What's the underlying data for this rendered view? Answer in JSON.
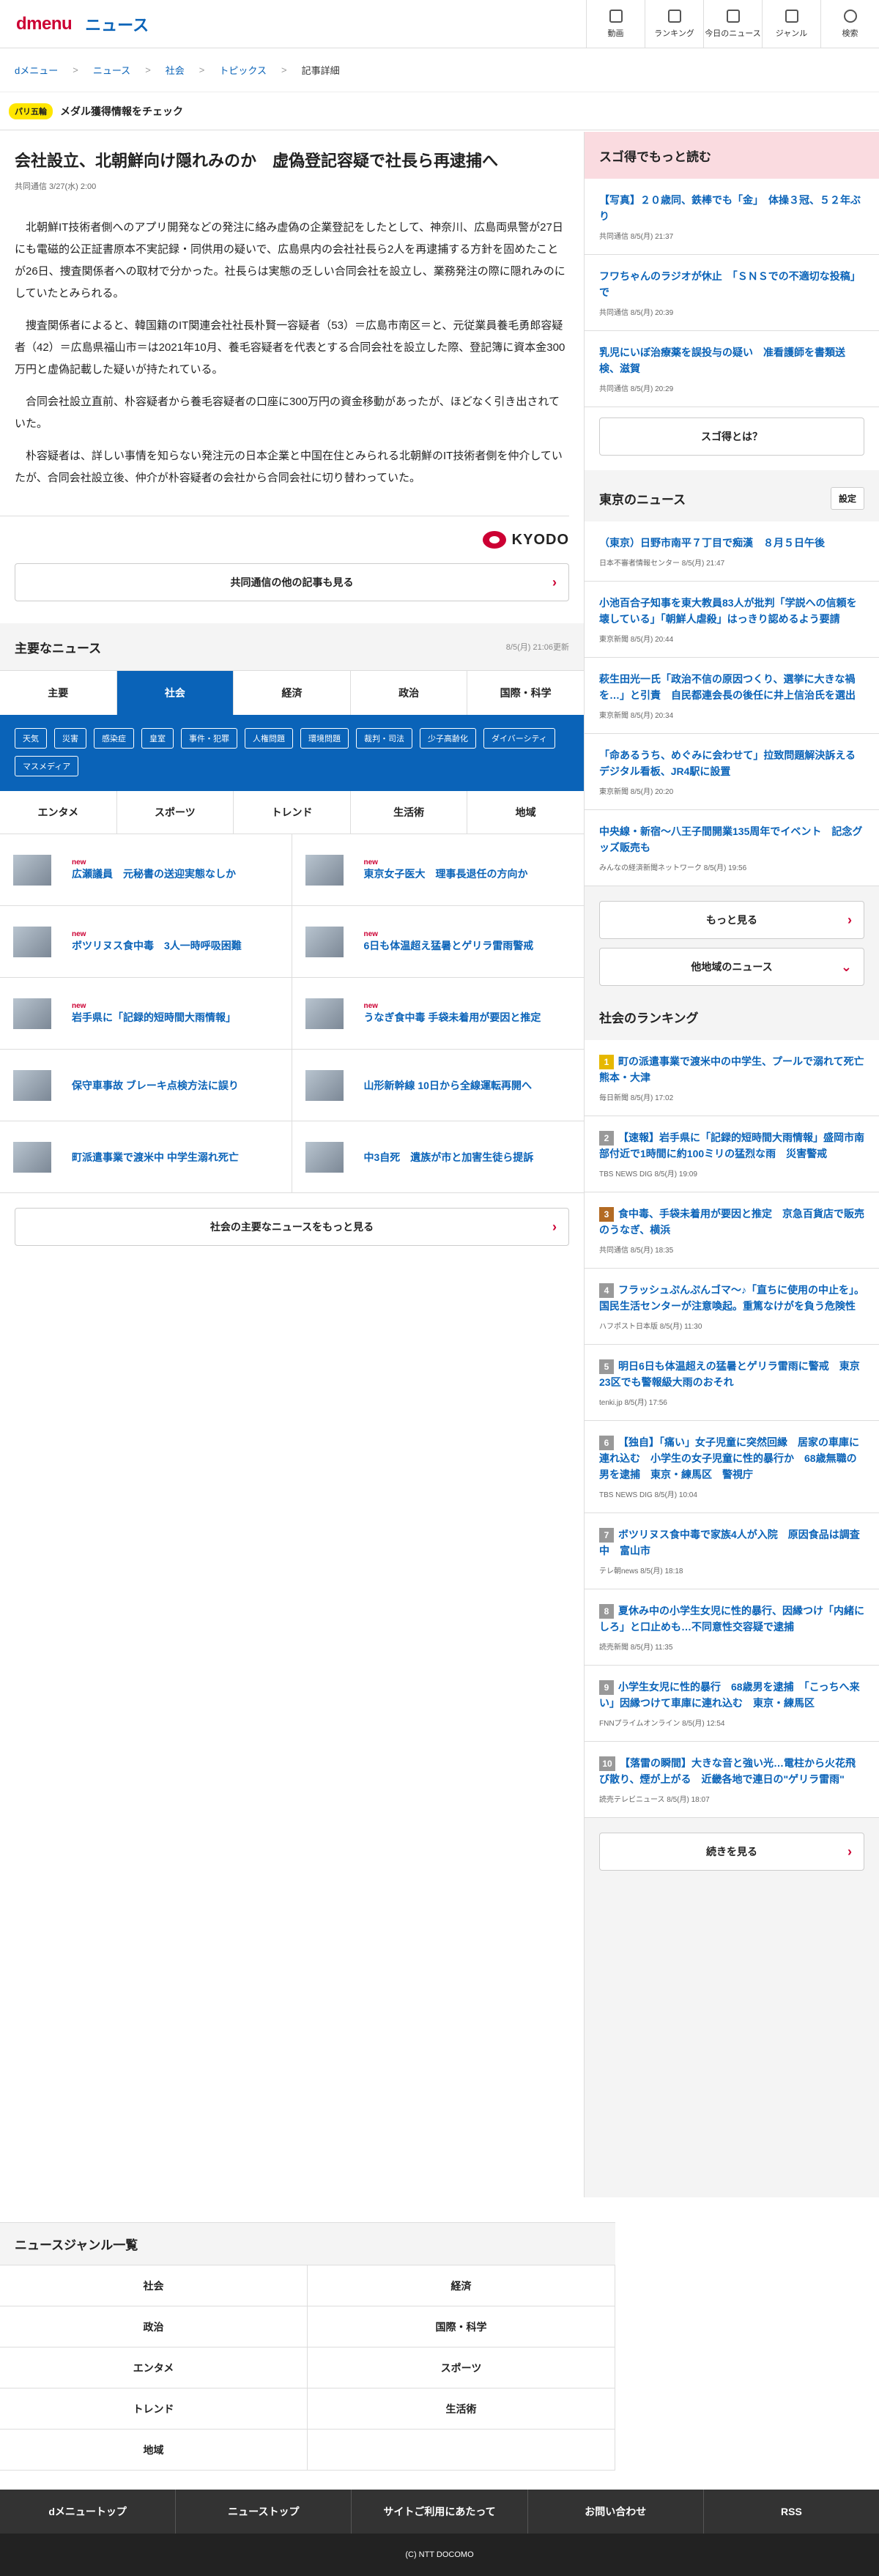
{
  "header": {
    "logo_d": "dmenu",
    "logo_news": "ニュース",
    "nav": [
      "動画",
      "ランキング",
      "今日のニュース",
      "ジャンル",
      "検索"
    ]
  },
  "breadcrumb": [
    "dメニュー",
    "ニュース",
    "社会",
    "トピックス",
    "記事詳細"
  ],
  "ticker": {
    "tag": "パリ五輪",
    "text": "メダル獲得情報をチェック"
  },
  "article": {
    "title": "会社設立、北朝鮮向け隠れみのか　虚偽登記容疑で社長ら再逮捕へ",
    "source": "共同通信 3/27(水) 2:00",
    "paragraphs": [
      "北朝鮮IT技術者側へのアプリ開発などの発注に絡み虚偽の企業登記をしたとして、神奈川、広島両県警が27日にも電磁的公正証書原本不実記録・同供用の疑いで、広島県内の会社社長ら2人を再逮捕する方針を固めたことが26日、捜査関係者への取材で分かった。社長らは実態の乏しい合同会社を設立し、業務発注の際に隠れみのにしていたとみられる。",
      "捜査関係者によると、韓国籍のIT関連会社社長朴賢一容疑者（53）＝広島市南区＝と、元従業員養毛勇郎容疑者（42）＝広島県福山市＝は2021年10月、養毛容疑者を代表とする合同会社を設立した際、登記簿に資本金300万円と虚偽記載した疑いが持たれている。",
      "合同会社設立直前、朴容疑者から養毛容疑者の口座に300万円の資金移動があったが、ほどなく引き出されていた。",
      "朴容疑者は、詳しい事情を知らない発注元の日本企業と中国在住とみられる北朝鮮のIT技術者側を仲介していたが、合同会社設立後、仲介が朴容疑者の会社から合同会社に切り替わっていた。"
    ],
    "kyodo": "KYODO",
    "more_btn": "共同通信の他の記事も見る"
  },
  "main_news": {
    "title": "主要なニュース",
    "updated": "8/5(月) 21:06更新",
    "tabs": [
      "主要",
      "社会",
      "経済",
      "政治",
      "国際・科学"
    ],
    "chips": [
      "天気",
      "災害",
      "感染症",
      "皇室",
      "事件・犯罪",
      "人権問題",
      "環境問題",
      "裁判・司法",
      "少子高齢化",
      "ダイバーシティ",
      "マスメディア"
    ],
    "subtabs": [
      "エンタメ",
      "スポーツ",
      "トレンド",
      "生活術",
      "地域"
    ],
    "items": [
      {
        "new": "new",
        "title": "広瀬議員　元秘書の送迎実態なしか"
      },
      {
        "new": "new",
        "title": "東京女子医大　理事長退任の方向か"
      },
      {
        "new": "new",
        "title": "ボツリヌス食中毒　3人一時呼吸困難"
      },
      {
        "new": "new",
        "title": "6日も体温超え猛暑とゲリラ雷雨警戒"
      },
      {
        "new": "new",
        "title": "岩手県に「記録的短時間大雨情報」"
      },
      {
        "new": "new",
        "title": "うなぎ食中毒 手袋未着用が要因と推定"
      },
      {
        "new": "",
        "title": "保守車事故 ブレーキ点検方法に誤り"
      },
      {
        "new": "",
        "title": "山形新幹線 10日から全線運転再開へ"
      },
      {
        "new": "",
        "title": "町派遣事業で渡米中 中学生溺れ死亡"
      },
      {
        "new": "",
        "title": "中3自死　遺族が市と加害生徒ら提訴"
      }
    ],
    "more_btn": "社会の主要なニュースをもっと見る"
  },
  "side": {
    "sugotoku": {
      "title": "スゴ得でもっと読む",
      "items": [
        {
          "h": "【写真】２０歳同、鉄棒でも「金」　体操３冠、５２年ぶり",
          "m": "共同通信 8/5(月) 21:37"
        },
        {
          "h": "フワちゃんのラジオが休止　「ＳＮＳでの不適切な投稿」で",
          "m": "共同通信 8/5(月) 20:39"
        },
        {
          "h": "乳児にいぼ治療薬を誤投与の疑い　准看護師を書類送検、滋賀",
          "m": "共同通信 8/5(月) 20:29"
        }
      ],
      "btn": "スゴ得とは？"
    },
    "tokyo": {
      "title": "東京のニュース",
      "set": "設定",
      "items": [
        {
          "h": "（東京）日野市南平７丁目で痴漢　８月５日午後",
          "m": "日本不審者情報センター 8/5(月) 21:47"
        },
        {
          "h": "小池百合子知事を東大教員83人が批判「学説への信頼を壊している」「朝鮮人虐殺」はっきり認めるよう要請",
          "m": "東京新聞 8/5(月) 20:44"
        },
        {
          "h": "萩生田光一氏「政治不信の原因つくり、選挙に大きな禍を…」と引責　自民都連会長の後任に井上信治氏を選出",
          "m": "東京新聞 8/5(月) 20:34"
        },
        {
          "h": "「命あるうち、めぐみに会わせて」拉致問題解決訴えるデジタル看板、JR4駅に設置",
          "m": "東京新聞 8/5(月) 20:20"
        },
        {
          "h": "中央線・新宿〜八王子間開業135周年でイベント　記念グッズ販売も",
          "m": "みんなの経済新聞ネットワーク 8/5(月) 19:56"
        }
      ],
      "more": "もっと見る",
      "other": "他地域のニュース"
    },
    "ranking": {
      "title": "社会のランキング",
      "items": [
        {
          "n": "1",
          "c": "#e6b800",
          "h": "町の派遣事業で渡米中の中学生、プールで溺れて死亡　熊本・大津",
          "m": "毎日新聞 8/5(月) 17:02"
        },
        {
          "n": "2",
          "c": "#999999",
          "h": "【速報】岩手県に「記録的短時間大雨情報」盛岡市南部付近で1時間に約100ミリの猛烈な雨　災害警戒",
          "m": "TBS NEWS DIG 8/5(月) 19:09"
        },
        {
          "n": "3",
          "c": "#b36b24",
          "h": "食中毒、手袋未着用が要因と推定　京急百貨店で販売のうなぎ、横浜",
          "m": "共同通信 8/5(月) 18:35"
        },
        {
          "n": "4",
          "c": "#999999",
          "h": "フラッシュぷんぷんゴマ〜♪「直ちに使用の中止を」。国民生活センターが注意喚起。重篤なけがを負う危険性",
          "m": "ハフポスト日本版 8/5(月) 11:30"
        },
        {
          "n": "5",
          "c": "#999999",
          "h": "明日6日も体温超えの猛暑とゲリラ雷雨に警戒　東京23区でも警報級大雨のおそれ",
          "m": "tenki.jp 8/5(月) 17:56"
        },
        {
          "n": "6",
          "c": "#999999",
          "h": "【独自】「痛い」女子児童に突然回縁　居家の車庫に連れ込む　小学生の女子児童に性的暴行か　68歳無職の男を逮捕　東京・練馬区　警視庁",
          "m": "TBS NEWS DIG 8/5(月) 10:04"
        },
        {
          "n": "7",
          "c": "#999999",
          "h": "ボツリヌス食中毒で家族4人が入院　原因食品は調査中　富山市",
          "m": "テレ朝news 8/5(月) 18:18"
        },
        {
          "n": "8",
          "c": "#999999",
          "h": "夏休み中の小学生女児に性的暴行、因縁つけ「内緒にしろ」と口止めも…不同意性交容疑で逮捕",
          "m": "読売新聞 8/5(月) 11:35"
        },
        {
          "n": "9",
          "c": "#999999",
          "h": "小学生女児に性的暴行　68歳男を逮捕　「こっちへ来い」因縁つけて車庫に連れ込む　東京・練馬区",
          "m": "FNNプライムオンライン 8/5(月) 12:54"
        },
        {
          "n": "10",
          "c": "#999999",
          "h": "【落雷の瞬間】大きな音と強い光…電柱から火花飛び散り、煙が上がる　近畿各地で連日の\"ゲリラ雷雨\"",
          "m": "読売テレビニュース 8/5(月) 18:07"
        }
      ],
      "btn": "続きを見る"
    }
  },
  "genre": {
    "title": "ニュースジャンル一覧",
    "items": [
      "社会",
      "経済",
      "政治",
      "国際・科学",
      "エンタメ",
      "スポーツ",
      "トレンド",
      "生活術",
      "地域",
      ""
    ]
  },
  "footer": {
    "links": [
      "dメニュートップ",
      "ニューストップ",
      "サイトご利用にあたって",
      "お問い合わせ",
      "RSS"
    ],
    "copy": "(C) NTT DOCOMO"
  }
}
